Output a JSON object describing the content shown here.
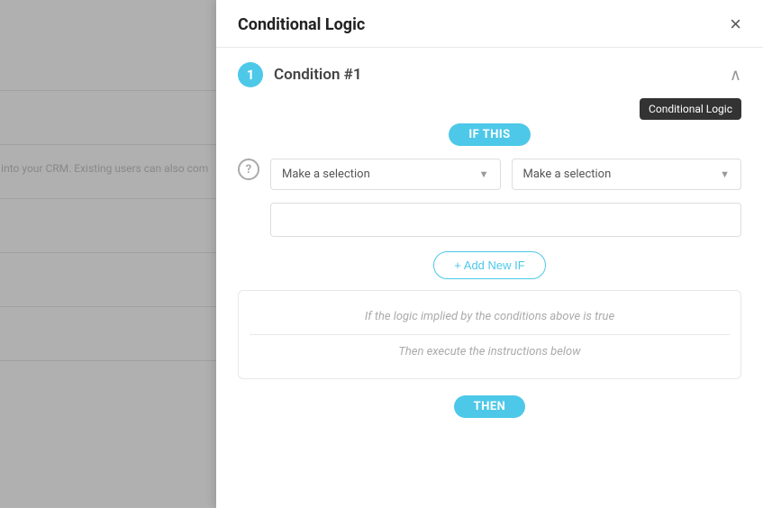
{
  "background": {
    "text": "ct into your CRM. Existing users can also com"
  },
  "modal": {
    "title": "Conditional Logic",
    "close_label": "×",
    "condition": {
      "number": "1",
      "title": "Condition #1"
    },
    "tooltip": {
      "label": "Conditional Logic"
    },
    "if_this": {
      "badge_label": "IF THIS",
      "dropdown1_placeholder": "Make a selection",
      "dropdown2_placeholder": "Make a selection",
      "text_input_placeholder": "",
      "add_new_if_label": "+ Add New IF",
      "help_icon": "?"
    },
    "logic_box": {
      "line1": "If the logic implied by the conditions above is true",
      "line2": "Then execute the instructions below"
    },
    "then": {
      "badge_label": "THEN"
    },
    "chevron_up": "∧",
    "double_chevron": "≫",
    "gear": "⚙"
  },
  "colors": {
    "accent": "#4dc8e8",
    "text_muted": "#aaa",
    "border": "#ddd"
  }
}
